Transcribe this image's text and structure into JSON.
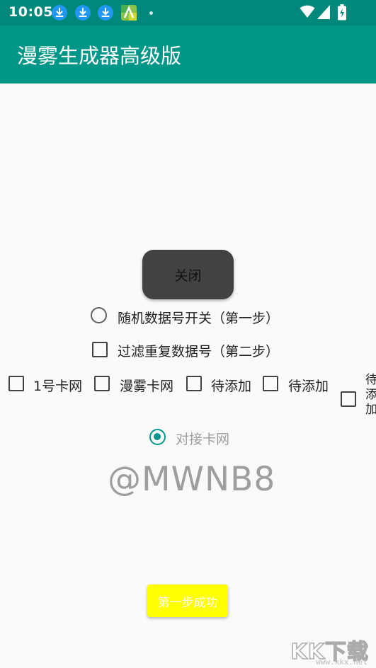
{
  "status_bar": {
    "time": "10:05"
  },
  "app_bar": {
    "title": "漫雾生成器高级版"
  },
  "main": {
    "close_button": "关闭",
    "random_switch": {
      "label": "随机数据号开关（第一步）",
      "checked": false
    },
    "filter_duplicates": {
      "label": "过滤重复数据号（第二步）",
      "checked": false
    },
    "card_options": [
      {
        "label": "1号卡网",
        "checked": false
      },
      {
        "label": "漫雾卡网",
        "checked": false
      },
      {
        "label": "待添加",
        "checked": false
      },
      {
        "label": "待添加",
        "checked": false
      },
      {
        "label": "待添加",
        "checked": false
      }
    ],
    "connect_card": {
      "label": "对接卡网",
      "checked": true
    },
    "handle": "@MWNB8",
    "success_button": "第一步成功"
  },
  "watermark": {
    "logo": "KK下载",
    "url": "www.kkx.net"
  },
  "colors": {
    "status_bar": "#00897b",
    "app_bar": "#009688",
    "accent": "#009688",
    "close_button_bg": "#424242",
    "success_button_bg": "#ffff00"
  }
}
